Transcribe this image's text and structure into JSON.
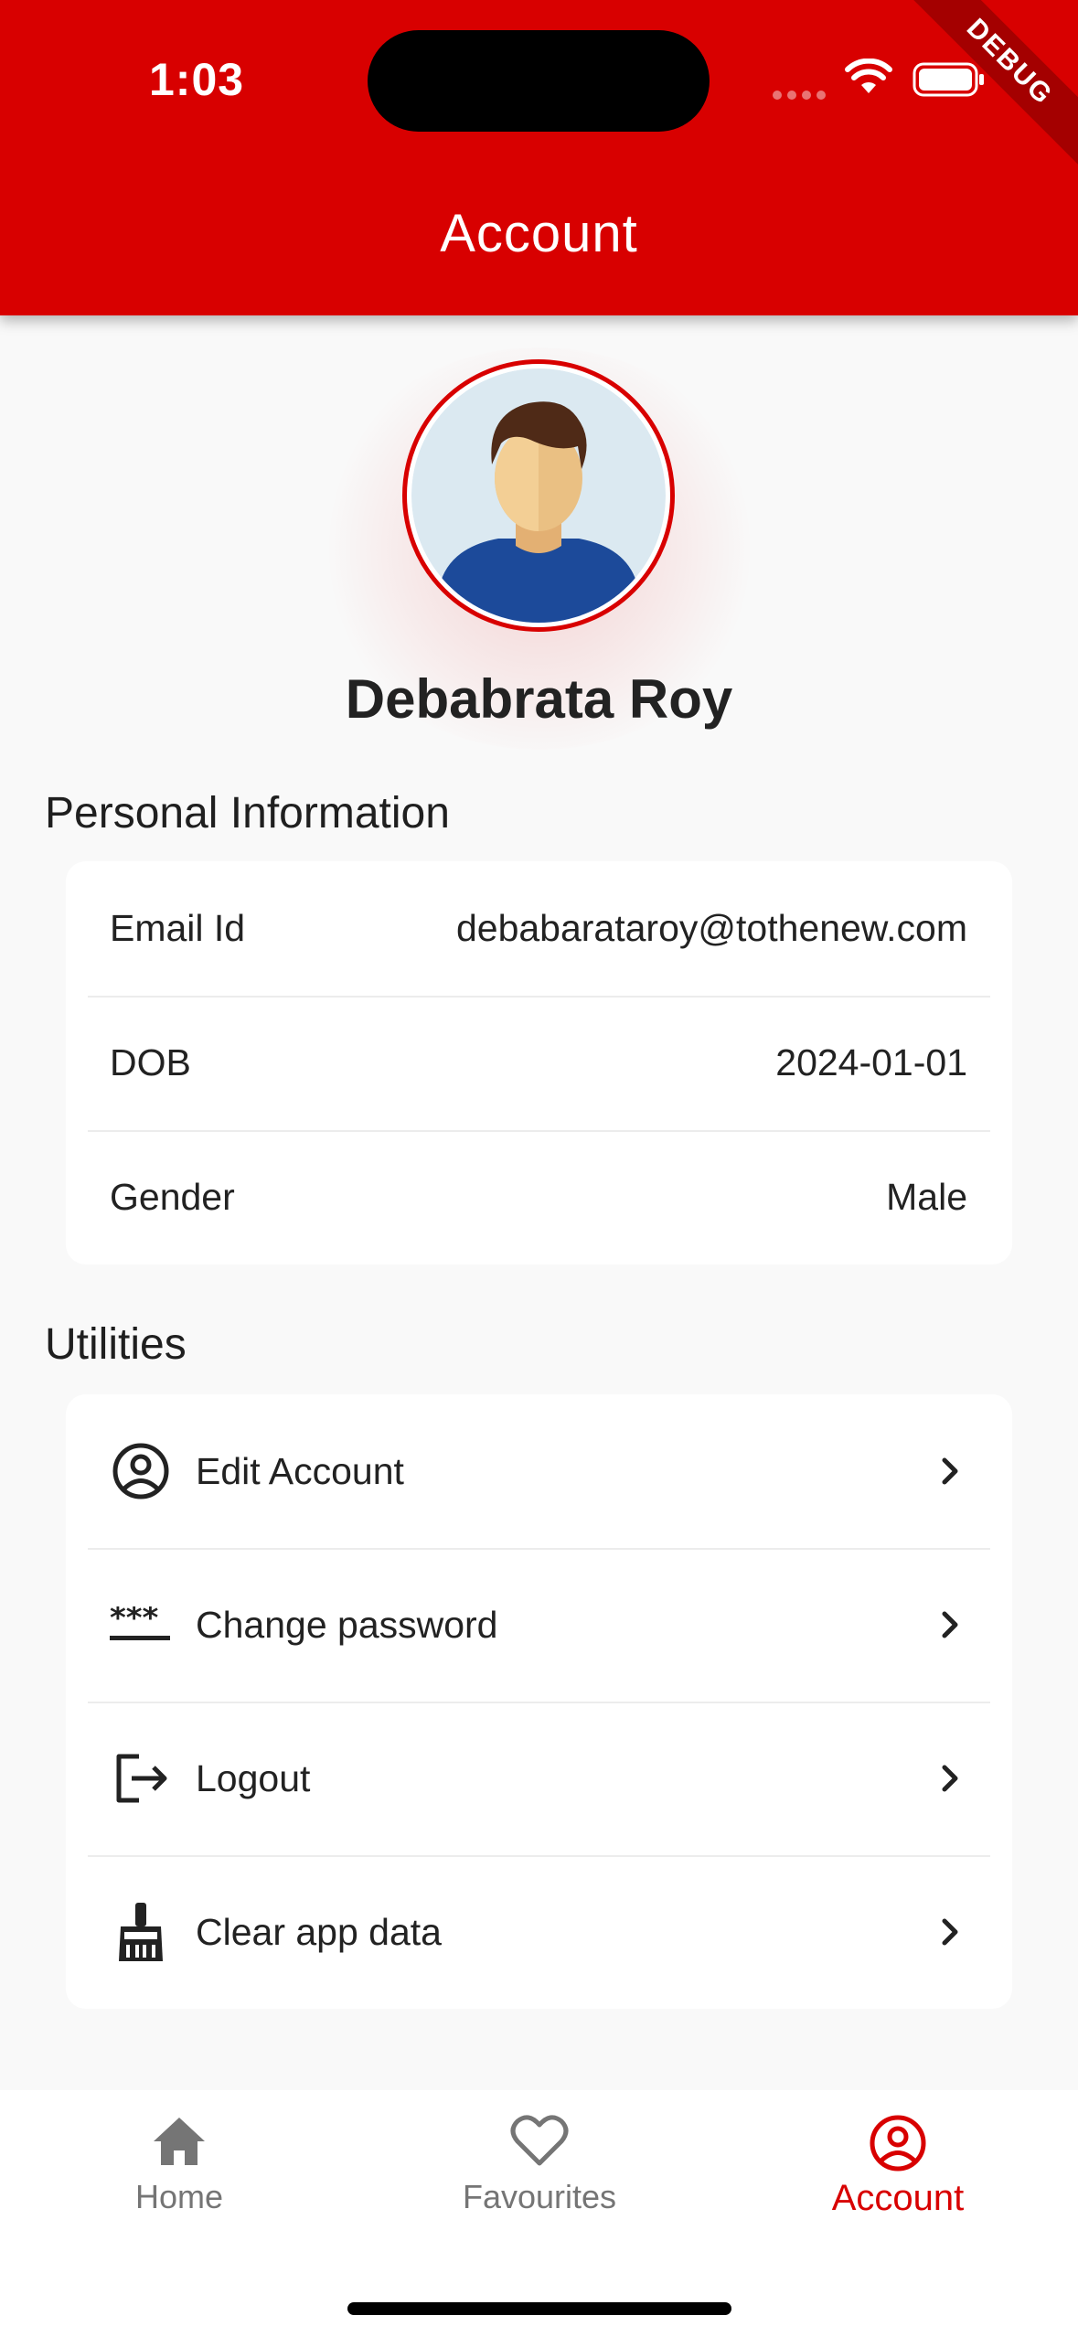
{
  "status_bar": {
    "time": "1:03",
    "debug_label": "DEBUG"
  },
  "app_bar": {
    "title": "Account"
  },
  "profile": {
    "name": "Debabrata Roy",
    "avatar_icon": "user-avatar-icon"
  },
  "personal_info": {
    "title": "Personal Information",
    "rows": [
      {
        "label": "Email Id",
        "value": "debabarataroy@tothenew.com"
      },
      {
        "label": "DOB",
        "value": "2024-01-01"
      },
      {
        "label": "Gender",
        "value": "Male"
      }
    ]
  },
  "utilities": {
    "title": "Utilities",
    "items": [
      {
        "label": "Edit Account",
        "icon": "account-circle-icon"
      },
      {
        "label": "Change password",
        "icon": "password-icon"
      },
      {
        "label": "Logout",
        "icon": "logout-icon"
      },
      {
        "label": "Clear app data",
        "icon": "cleaning-brush-icon"
      }
    ]
  },
  "bottom_nav": {
    "items": [
      {
        "label": "Home",
        "icon": "home-icon",
        "active": false
      },
      {
        "label": "Favourites",
        "icon": "heart-icon",
        "active": false
      },
      {
        "label": "Account",
        "icon": "account-circle-icon",
        "active": true
      }
    ]
  },
  "colors": {
    "primary": "#d80000",
    "background": "#f9f9f9",
    "card": "#ffffff",
    "inactive_nav": "#757575"
  }
}
